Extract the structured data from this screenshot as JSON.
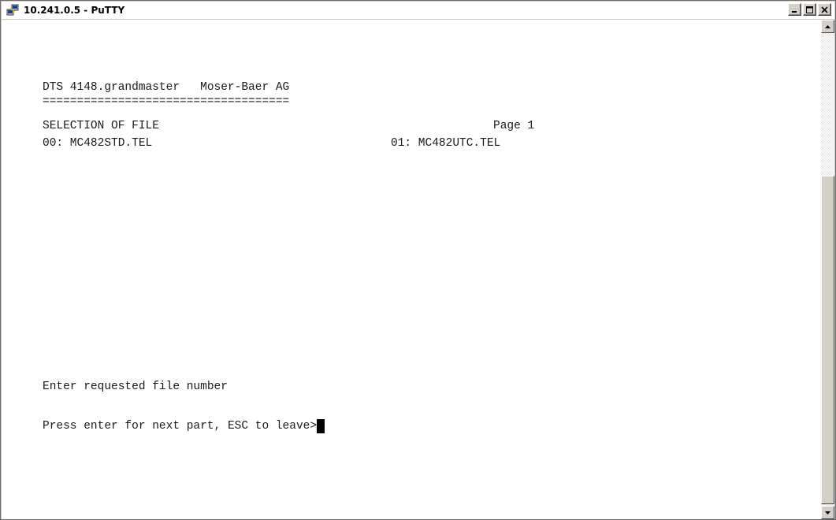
{
  "window": {
    "title": "10.241.0.5 - PuTTY",
    "icon": "putty-icon",
    "controls": [
      "minimize-icon",
      "maximize-icon",
      "close-icon"
    ]
  },
  "terminal": {
    "header": "DTS 4148.grandmaster   Moser-Baer AG",
    "underline": "====================================",
    "section_title": "SELECTION OF FILE",
    "page_label": "Page 1",
    "files": [
      {
        "label": "00: MC482STD.TEL"
      },
      {
        "label": "01: MC482UTC.TEL"
      }
    ],
    "prompt_request": "Enter requested file number",
    "prompt_next": "Press enter for next part, ESC to leave>"
  },
  "scrollbar": {
    "up_icon": "arrow-up-icon",
    "down_icon": "arrow-down-icon"
  },
  "colors": {
    "terminal_background": "#ffffff",
    "terminal_text": "#1a1a1a",
    "cursor": "#000000"
  }
}
